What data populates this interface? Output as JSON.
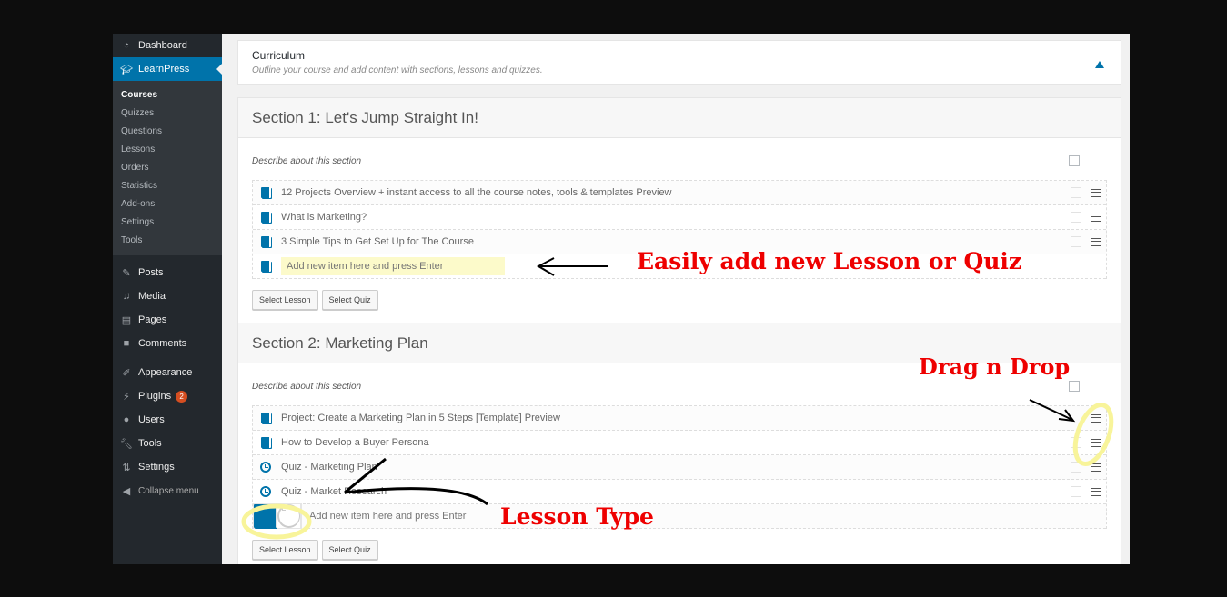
{
  "sidebar": {
    "top": [
      {
        "label": "Dashboard",
        "icon": "dashboard-icon"
      },
      {
        "label": "LearnPress",
        "icon": "graduation-cap-icon"
      }
    ],
    "submenu": [
      "Courses",
      "Quizzes",
      "Questions",
      "Lessons",
      "Orders",
      "Statistics",
      "Add-ons",
      "Settings",
      "Tools"
    ],
    "group1": [
      {
        "label": "Posts",
        "icon": "pin-icon"
      },
      {
        "label": "Media",
        "icon": "media-icon"
      },
      {
        "label": "Pages",
        "icon": "pages-icon"
      },
      {
        "label": "Comments",
        "icon": "comment-icon"
      }
    ],
    "group2": [
      {
        "label": "Appearance",
        "icon": "brush-icon"
      },
      {
        "label": "Plugins",
        "icon": "plugin-icon",
        "badge": "2"
      },
      {
        "label": "Users",
        "icon": "user-icon"
      },
      {
        "label": "Tools",
        "icon": "wrench-icon"
      },
      {
        "label": "Settings",
        "icon": "settings-icon"
      }
    ],
    "collapse": "Collapse menu"
  },
  "curriculum": {
    "title": "Curriculum",
    "description": "Outline your course and add content with sections, lessons and quizzes."
  },
  "sections": [
    {
      "title": "Section 1: Let's Jump Straight In!",
      "description_placeholder": "Describe about this section",
      "items": [
        {
          "type": "lesson",
          "title": "12 Projects Overview + instant access to all the course notes, tools & templates Preview"
        },
        {
          "type": "lesson",
          "title": "What is Marketing?"
        },
        {
          "type": "lesson",
          "title": "3 Simple Tips to Get Set Up for The Course"
        }
      ],
      "new_item_placeholder": "Add new item here and press Enter",
      "select_lesson": "Select Lesson",
      "select_quiz": "Select Quiz"
    },
    {
      "title": "Section 2: Marketing Plan",
      "description_placeholder": "Describe about this section",
      "items": [
        {
          "type": "lesson",
          "title": "Project: Create a Marketing Plan in 5 Steps [Template] Preview"
        },
        {
          "type": "lesson",
          "title": "How to Develop a Buyer Persona"
        },
        {
          "type": "quiz",
          "title": "Quiz - Marketing Plan"
        },
        {
          "type": "quiz",
          "title": "Quiz - Market Research"
        }
      ],
      "new_item_placeholder": "Add new item here and press Enter",
      "select_lesson": "Select Lesson",
      "select_quiz": "Select Quiz"
    }
  ],
  "annotations": {
    "add": "Easily add new Lesson or Quiz",
    "drag": "Drag n Drop",
    "type": "Lesson Type"
  },
  "colors": {
    "accent": "#0073aa",
    "annotation": "#ee0000",
    "sidebar": "#23282d"
  }
}
